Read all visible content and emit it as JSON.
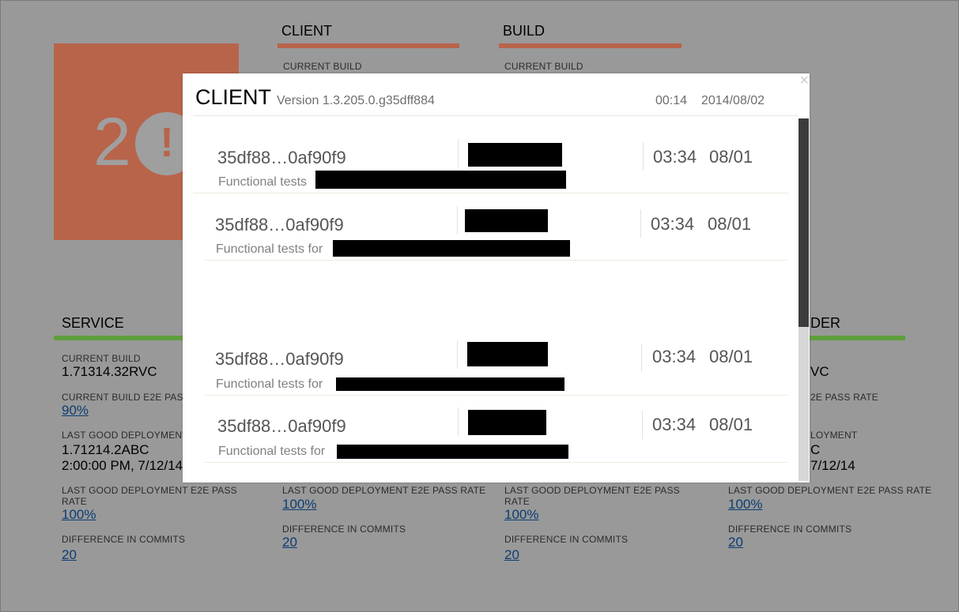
{
  "background": {
    "tile": {
      "count": "2",
      "alert_symbol": "!"
    },
    "sections": {
      "client": {
        "title": "CLIENT",
        "current_build_label": "CURRENT BUILD"
      },
      "build": {
        "title": "BUILD",
        "current_build_label": "CURRENT BUILD"
      },
      "service": {
        "title": "SERVICE",
        "current_build_label": "CURRENT BUILD",
        "current_build": "1.71314.32RVC",
        "e2e_label": "CURRENT BUILD E2E PASS",
        "e2e_value": "90%",
        "last_good_label": "LAST GOOD DEPLOYMENT",
        "last_good_version": "1.71214.2ABC",
        "last_good_time": "2:00:00 PM, 7/12/14",
        "last_good_e2e_label": "LAST GOOD DEPLOYMENT E2E PASS RATE",
        "last_good_e2e_value": "100%",
        "diff_label": "DIFFERENCE IN COMMITS",
        "diff_value": "20"
      },
      "col2": {
        "last_good_e2e_label": "LAST GOOD DEPLOYMENT E2E PASS RATE",
        "last_good_e2e_value": "100%",
        "diff_label": "DIFFERENCE IN COMMITS",
        "diff_value": "20"
      },
      "col3": {
        "last_good_e2e_label": "LAST GOOD DEPLOYMENT E2E PASS RATE",
        "last_good_e2e_value": "100%",
        "diff_label": "DIFFERENCE IN COMMITS",
        "diff_value": "20"
      },
      "col4": {
        "title_fragment": "DER",
        "current_build_fragment": "VC",
        "e2e_label_fragment": "2E PASS RATE",
        "last_good_label_fragment": "LOYMENT",
        "last_good_version_fragment": "C",
        "last_good_time_fragment": "7/12/14",
        "last_good_e2e_label": "LAST GOOD DEPLOYMENT E2E PASS RATE",
        "last_good_e2e_value": "100%",
        "diff_label": "DIFFERENCE IN COMMITS",
        "diff_value": "20"
      }
    }
  },
  "modal": {
    "title": "CLIENT",
    "version": "Version 1.3.205.0.g35dff884",
    "time": "00:14",
    "date": "2014/08/02",
    "close_symbol": "×",
    "rows": [
      {
        "hash": "35df88…0af90f9",
        "description": "Functional tests",
        "time": "03:34",
        "date": "08/01"
      },
      {
        "hash": "35df88…0af90f9",
        "description": "Functional tests for",
        "time": "03:34",
        "date": "08/01"
      },
      {
        "hash": "35df88…0af90f9",
        "description": "Functional tests for",
        "time": "03:34",
        "date": "08/01"
      },
      {
        "hash": "35df88…0af90f9",
        "description": "Functional tests for",
        "time": "03:34",
        "date": "08/01"
      }
    ]
  },
  "colors": {
    "tile_accent": "#b8644a",
    "service_bar": "#5f9f3d",
    "link": "#0c3d72",
    "overlay": "#999999"
  }
}
